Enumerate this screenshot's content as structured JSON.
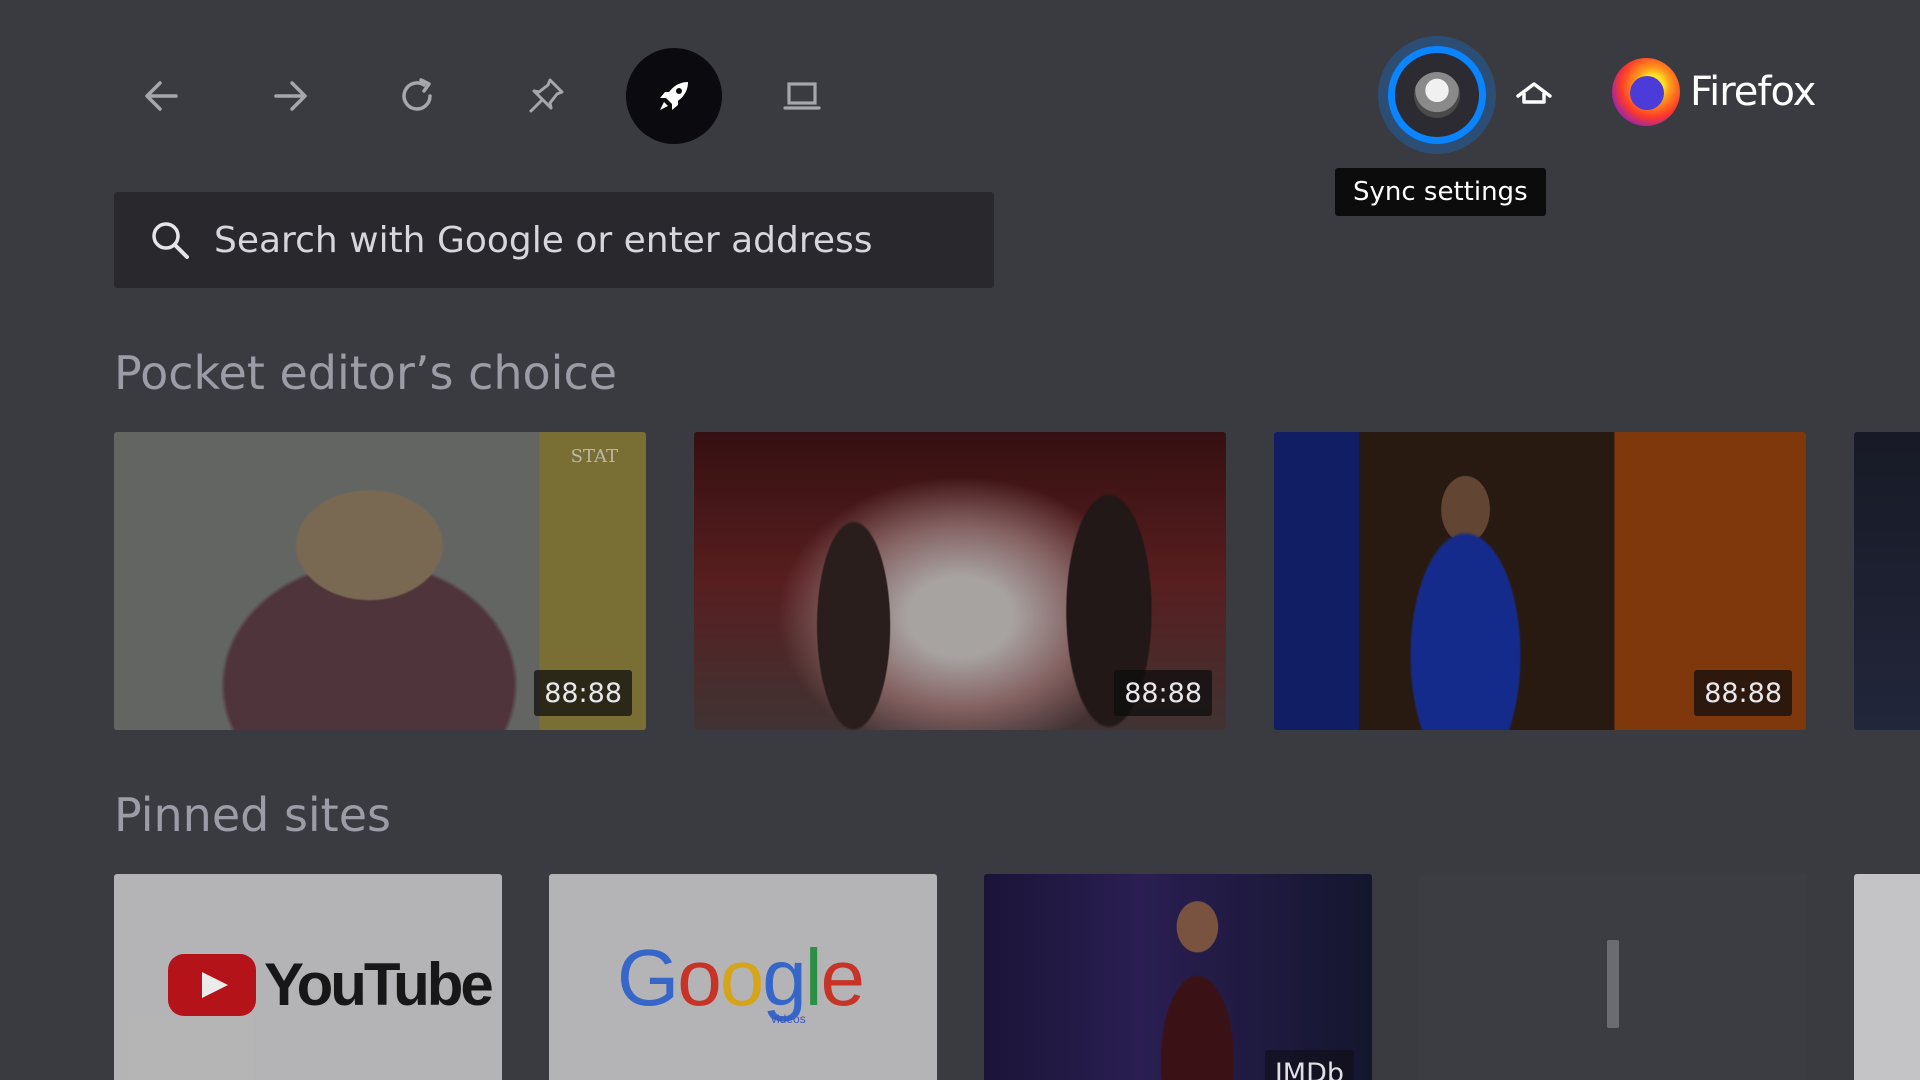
{
  "toolbar": {
    "buttons": [
      {
        "name": "back",
        "icon": "arrow-left-icon"
      },
      {
        "name": "forward",
        "icon": "arrow-right-icon"
      },
      {
        "name": "reload",
        "icon": "reload-icon"
      },
      {
        "name": "pin",
        "icon": "pin-icon"
      },
      {
        "name": "pocket",
        "icon": "rocket-icon",
        "active": true
      },
      {
        "name": "desktop-mode",
        "icon": "laptop-icon"
      }
    ],
    "sync_tooltip": "Sync settings",
    "home_icon": "home-icon"
  },
  "brand": {
    "name": "Firefox",
    "logo_icon": "firefox-logo-icon"
  },
  "search": {
    "placeholder": "Search with Google or enter address",
    "value": ""
  },
  "pocket": {
    "title": "Pocket editor’s choice",
    "cards": [
      {
        "duration": "88:88",
        "watermark": "STAT"
      },
      {
        "duration": "88:88"
      },
      {
        "duration": "88:88"
      }
    ]
  },
  "pinned": {
    "title": "Pinned sites",
    "tiles": [
      {
        "logo_text": "YouTube"
      },
      {
        "logo_text": "Google",
        "logo_subtext": "videos"
      },
      {
        "label": "IMDb"
      },
      {
        "label": ""
      }
    ]
  },
  "colors": {
    "background": "#3a3a41",
    "focus_ring": "#0a84ff",
    "tooltip_bg": "#0c0c0d",
    "search_bg": "#28282d",
    "section_title": "#9c9ca6"
  }
}
